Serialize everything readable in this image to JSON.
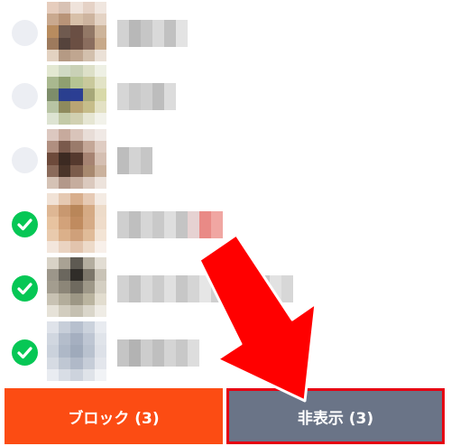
{
  "contacts": [
    {
      "selected": false,
      "avatar": [
        "#e6cdbd",
        "#d8c2b4",
        "#efe3db",
        "#e5d2c6",
        "#f0e6df",
        "#c9a98f",
        "#b89478",
        "#d7c0a9",
        "#cdb49f",
        "#e4d3c4",
        "#b88c5f",
        "#6f5a4f",
        "#6a4f44",
        "#927866",
        "#cdb49a",
        "#9d7a5d",
        "#55433c",
        "#6b4f43",
        "#8a6d5e",
        "#c7a98a",
        "#e3d2c1",
        "#b59a84",
        "#c0a690",
        "#d3c0ad",
        "#ebe1d7"
      ],
      "name_mosaic": [
        "#d2d2d2",
        "#b8b8b8",
        "#c6c6c6",
        "#d9d9d9",
        "#c1c1c1",
        "#e3e3e3"
      ]
    },
    {
      "selected": false,
      "avatar": [
        "#e3e8d2",
        "#d0d9c4",
        "#c9d1b6",
        "#dde0c8",
        "#eef0e4",
        "#a9b88f",
        "#8f9f70",
        "#b6c493",
        "#c9c99c",
        "#e2e3c6",
        "#7d8d6a",
        "#2a3f8f",
        "#2b3e93",
        "#a7a879",
        "#d8d9a9",
        "#b8c4a4",
        "#8e8a5d",
        "#b9a474",
        "#c6bd8a",
        "#e3e1c4",
        "#dde3d2",
        "#c3caa7",
        "#d1d0b1",
        "#e6e6d3",
        "#f2f2ea"
      ],
      "name_mosaic": [
        "#d6d6d6",
        "#c8c8c8",
        "#cfcfcf",
        "#bdbdbd",
        "#dcdcdc"
      ]
    },
    {
      "selected": false,
      "avatar": [
        "#dcc8c0",
        "#c7aa9d",
        "#d9c4ba",
        "#e8ddd7",
        "#f0e9e5",
        "#b08f80",
        "#7a5a4c",
        "#9a7b6b",
        "#c4a797",
        "#dfccc2",
        "#6d4a3b",
        "#3c2a22",
        "#55392e",
        "#a68372",
        "#d5bfb2",
        "#8a6a5a",
        "#4a3429",
        "#7c5c4b",
        "#a8896f",
        "#cbb29d",
        "#d5c2b5",
        "#b3988a",
        "#c6ad9e",
        "#dbc9be",
        "#ede3dc"
      ],
      "name_mosaic": [
        "#bdbdbd",
        "#d3d3d3",
        "#c6c6c6"
      ]
    },
    {
      "selected": true,
      "avatar": [
        "#f1e2d6",
        "#e5c9b2",
        "#d8ae8c",
        "#e6cab4",
        "#f4ebe3",
        "#deb794",
        "#c89870",
        "#b98659",
        "#d5aa84",
        "#eddbc9",
        "#e7c3a0",
        "#d2a27a",
        "#c08b5f",
        "#d6ab86",
        "#efdcca",
        "#e9caad",
        "#dbb08a",
        "#cfa07a",
        "#e0bb98",
        "#f3e4d5",
        "#f3e6dc",
        "#ead3c1",
        "#e2c4ad",
        "#eddac9",
        "#f8f0ea"
      ],
      "name_mosaic": [
        "#cfcfcf",
        "#bfbfbf",
        "#d6d6d6",
        "#c9c9c9",
        "#dedede",
        "#c4c4c4",
        "#e6d2d2",
        "#e98a86",
        "#f0a6a2"
      ]
    },
    {
      "selected": true,
      "avatar": [
        "#d8d2c6",
        "#a9a294",
        "#5e5a52",
        "#b3ad9f",
        "#e2ddd3",
        "#9c968a",
        "#6b675e",
        "#302d29",
        "#7c766a",
        "#c9c3b6",
        "#a39d8f",
        "#8c8678",
        "#6f6a5f",
        "#9e9888",
        "#d4cfc2",
        "#c8c2b3",
        "#b3ad9b",
        "#9d9785",
        "#bab49f",
        "#e2ddcf",
        "#e6e2d8",
        "#d2cdbf",
        "#c5c0b1",
        "#dad6ca",
        "#efece5"
      ],
      "name_mosaic": [
        "#d2d2d2",
        "#c3c3c3",
        "#dadada",
        "#cccccc",
        "#e0e0e0",
        "#c7c7c7",
        "#d5d5d5",
        "#e6e6e6",
        "#cfcfcf",
        "#dbdbdb",
        "#e3e3e3",
        "#d0d0d0",
        "#c9c9c9",
        "#e2e2e2",
        "#d7d7d7"
      ]
    },
    {
      "selected": true,
      "avatar": [
        "#dfe3ea",
        "#c7ced9",
        "#b7c0ce",
        "#cbd2dc",
        "#e8ebf0",
        "#d1d7e0",
        "#b4bdcb",
        "#a5afc0",
        "#bec6d3",
        "#e0e4ea",
        "#cbd2dc",
        "#aeb8c7",
        "#9faabb",
        "#b9c2cf",
        "#dde1e8",
        "#d6dbe3",
        "#bfc7d3",
        "#b0b9c8",
        "#c6cdd8",
        "#e3e6ec",
        "#e9ecf1",
        "#d8dde5",
        "#cdd3dd",
        "#dfe3e9",
        "#f1f3f6"
      ],
      "name_mosaic": [
        "#c5c5c5",
        "#b3b3b3",
        "#cdcdcd",
        "#bfbfbf",
        "#d4d4d4",
        "#c8c8c8",
        "#dddddd"
      ]
    }
  ],
  "buttons": {
    "block_label": "ブロック (3)",
    "hide_label": "非表示 (3)"
  },
  "colors": {
    "block": "#fc4c13",
    "hide": "#6a7487",
    "check_on": "#06c755",
    "check_off": "#eceef3",
    "annotation_red": "#e60012"
  }
}
